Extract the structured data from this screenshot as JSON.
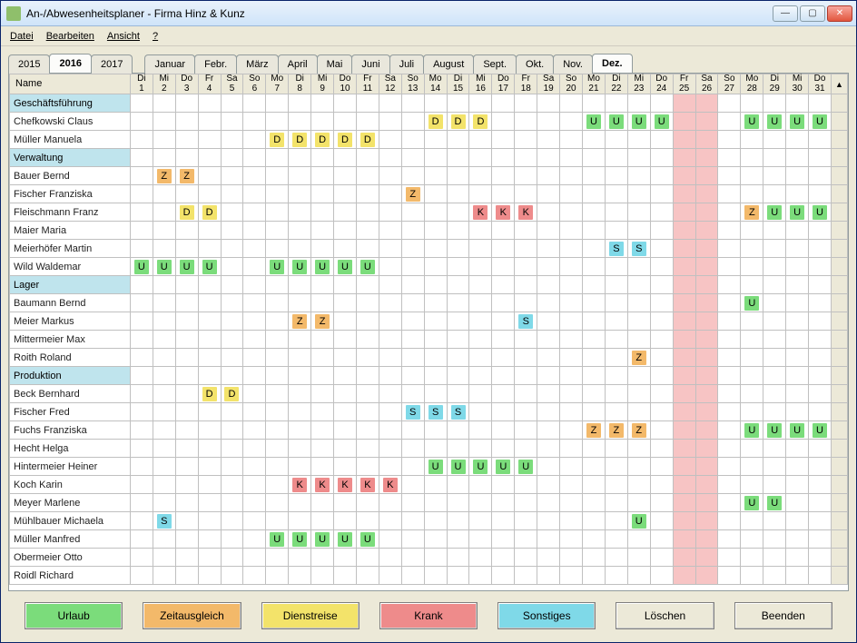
{
  "window": {
    "title": "An-/Abwesenheitsplaner - Firma Hinz & Kunz"
  },
  "menu": {
    "file": "Datei",
    "edit": "Bearbeiten",
    "view": "Ansicht",
    "help": "?"
  },
  "years": [
    "2015",
    "2016",
    "2017"
  ],
  "year_active": 1,
  "months": [
    "Januar",
    "Febr.",
    "März",
    "April",
    "Mai",
    "Juni",
    "Juli",
    "August",
    "Sept.",
    "Okt.",
    "Nov.",
    "Dez."
  ],
  "month_active": 11,
  "name_header": "Name",
  "days": [
    {
      "w": "Di",
      "n": "1"
    },
    {
      "w": "Mi",
      "n": "2"
    },
    {
      "w": "Do",
      "n": "3"
    },
    {
      "w": "Fr",
      "n": "4"
    },
    {
      "w": "Sa",
      "n": "5"
    },
    {
      "w": "So",
      "n": "6"
    },
    {
      "w": "Mo",
      "n": "7"
    },
    {
      "w": "Di",
      "n": "8"
    },
    {
      "w": "Mi",
      "n": "9"
    },
    {
      "w": "Do",
      "n": "10"
    },
    {
      "w": "Fr",
      "n": "11"
    },
    {
      "w": "Sa",
      "n": "12"
    },
    {
      "w": "So",
      "n": "13"
    },
    {
      "w": "Mo",
      "n": "14"
    },
    {
      "w": "Di",
      "n": "15"
    },
    {
      "w": "Mi",
      "n": "16"
    },
    {
      "w": "Do",
      "n": "17"
    },
    {
      "w": "Fr",
      "n": "18"
    },
    {
      "w": "Sa",
      "n": "19"
    },
    {
      "w": "So",
      "n": "20"
    },
    {
      "w": "Mo",
      "n": "21"
    },
    {
      "w": "Di",
      "n": "22"
    },
    {
      "w": "Mi",
      "n": "23"
    },
    {
      "w": "Do",
      "n": "24"
    },
    {
      "w": "Fr",
      "n": "25"
    },
    {
      "w": "Sa",
      "n": "26"
    },
    {
      "w": "So",
      "n": "27"
    },
    {
      "w": "Mo",
      "n": "28"
    },
    {
      "w": "Di",
      "n": "29"
    },
    {
      "w": "Mi",
      "n": "30"
    },
    {
      "w": "Do",
      "n": "31"
    }
  ],
  "highlight_cols": [
    24,
    25
  ],
  "rows": [
    {
      "name": "Geschäftsführung",
      "group": true
    },
    {
      "name": "Chefkowski Claus",
      "cells": {
        "14": "D",
        "15": "D",
        "16": "D",
        "21": "U",
        "22": "U",
        "23": "U",
        "24": "U",
        "28": "U",
        "29": "U",
        "30": "U",
        "31": "U"
      }
    },
    {
      "name": "Müller Manuela",
      "cells": {
        "7": "D",
        "8": "D",
        "9": "D",
        "10": "D",
        "11": "D"
      }
    },
    {
      "name": "Verwaltung",
      "group": true
    },
    {
      "name": "Bauer Bernd",
      "cells": {
        "2": "Z",
        "3": "Z"
      }
    },
    {
      "name": "Fischer Franziska",
      "cells": {
        "13": "Z"
      }
    },
    {
      "name": "Fleischmann Franz",
      "cells": {
        "3": "D",
        "4": "D",
        "16": "K",
        "17": "K",
        "18": "K",
        "28": "Z",
        "29": "U",
        "30": "U",
        "31": "U"
      }
    },
    {
      "name": "Maier Maria"
    },
    {
      "name": "Meierhöfer Martin",
      "cells": {
        "22": "S",
        "23": "S"
      }
    },
    {
      "name": "Wild Waldemar",
      "cells": {
        "1": "U",
        "2": "U",
        "3": "U",
        "4": "U",
        "7": "U",
        "8": "U",
        "9": "U",
        "10": "U",
        "11": "U"
      }
    },
    {
      "name": "Lager",
      "group": true
    },
    {
      "name": "Baumann Bernd",
      "cells": {
        "28": "U"
      }
    },
    {
      "name": "Meier Markus",
      "cells": {
        "8": "Z",
        "9": "Z",
        "18": "S"
      }
    },
    {
      "name": "Mittermeier Max"
    },
    {
      "name": "Roith Roland",
      "cells": {
        "23": "Z"
      }
    },
    {
      "name": "Produktion",
      "group": true
    },
    {
      "name": "Beck Bernhard",
      "cells": {
        "4": "D",
        "5": "D"
      }
    },
    {
      "name": "Fischer Fred",
      "cells": {
        "13": "S",
        "14": "S",
        "15": "S"
      }
    },
    {
      "name": "Fuchs Franziska",
      "cells": {
        "21": "Z",
        "22": "Z",
        "23": "Z",
        "28": "U",
        "29": "U",
        "30": "U",
        "31": "U"
      }
    },
    {
      "name": "Hecht Helga"
    },
    {
      "name": "Hintermeier Heiner",
      "cells": {
        "14": "U",
        "15": "U",
        "16": "U",
        "17": "U",
        "18": "U"
      }
    },
    {
      "name": "Koch Karin",
      "cells": {
        "8": "K",
        "9": "K",
        "10": "K",
        "11": "K",
        "12": "K"
      }
    },
    {
      "name": "Meyer Marlene",
      "cells": {
        "28": "U",
        "29": "U"
      }
    },
    {
      "name": "Mühlbauer Michaela",
      "cells": {
        "2": "S",
        "23": "U"
      }
    },
    {
      "name": "Müller Manfred",
      "cells": {
        "7": "U",
        "8": "U",
        "9": "U",
        "10": "U",
        "11": "U"
      }
    },
    {
      "name": "Obermeier Otto"
    },
    {
      "name": "Roidl Richard"
    }
  ],
  "buttons": {
    "urlaub": "Urlaub",
    "zeit": "Zeitausgleich",
    "dienst": "Dienstreise",
    "krank": "Krank",
    "sonst": "Sonstiges",
    "loeschen": "Löschen",
    "beenden": "Beenden"
  }
}
